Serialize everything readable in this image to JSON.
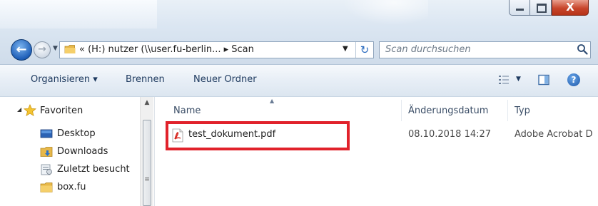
{
  "window": {
    "minimize_glyph": "–",
    "maximize_glyph": "□",
    "close_glyph": "X"
  },
  "address_bar": {
    "path": "« (H:) nutzer (\\\\user.fu-berlin... ▸ Scan"
  },
  "search": {
    "placeholder": "Scan durchsuchen"
  },
  "toolbar": {
    "organize": "Organisieren ▾",
    "burn": "Brennen",
    "new_folder": "Neuer Ordner"
  },
  "nav_pane": {
    "favorites_label": "Favoriten",
    "items": [
      {
        "label": "Desktop",
        "icon": "desktop-icon"
      },
      {
        "label": "Downloads",
        "icon": "downloads-folder-icon"
      },
      {
        "label": "Zuletzt besucht",
        "icon": "recent-places-icon"
      },
      {
        "label": "box.fu",
        "icon": "folder-icon"
      }
    ]
  },
  "file_list": {
    "columns": [
      "Name",
      "Änderungsdatum",
      "Typ"
    ],
    "rows": [
      {
        "name": "test_dokument.pdf",
        "modified": "08.10.2018 14:27",
        "type": "Adobe Acrobat D",
        "icon": "pdf-file-icon"
      }
    ]
  },
  "colors": {
    "highlight_border": "#e1222b",
    "window_chrome": "#cfdcea",
    "close_button": "#c8452b",
    "link_text": "#1e3a5f"
  }
}
